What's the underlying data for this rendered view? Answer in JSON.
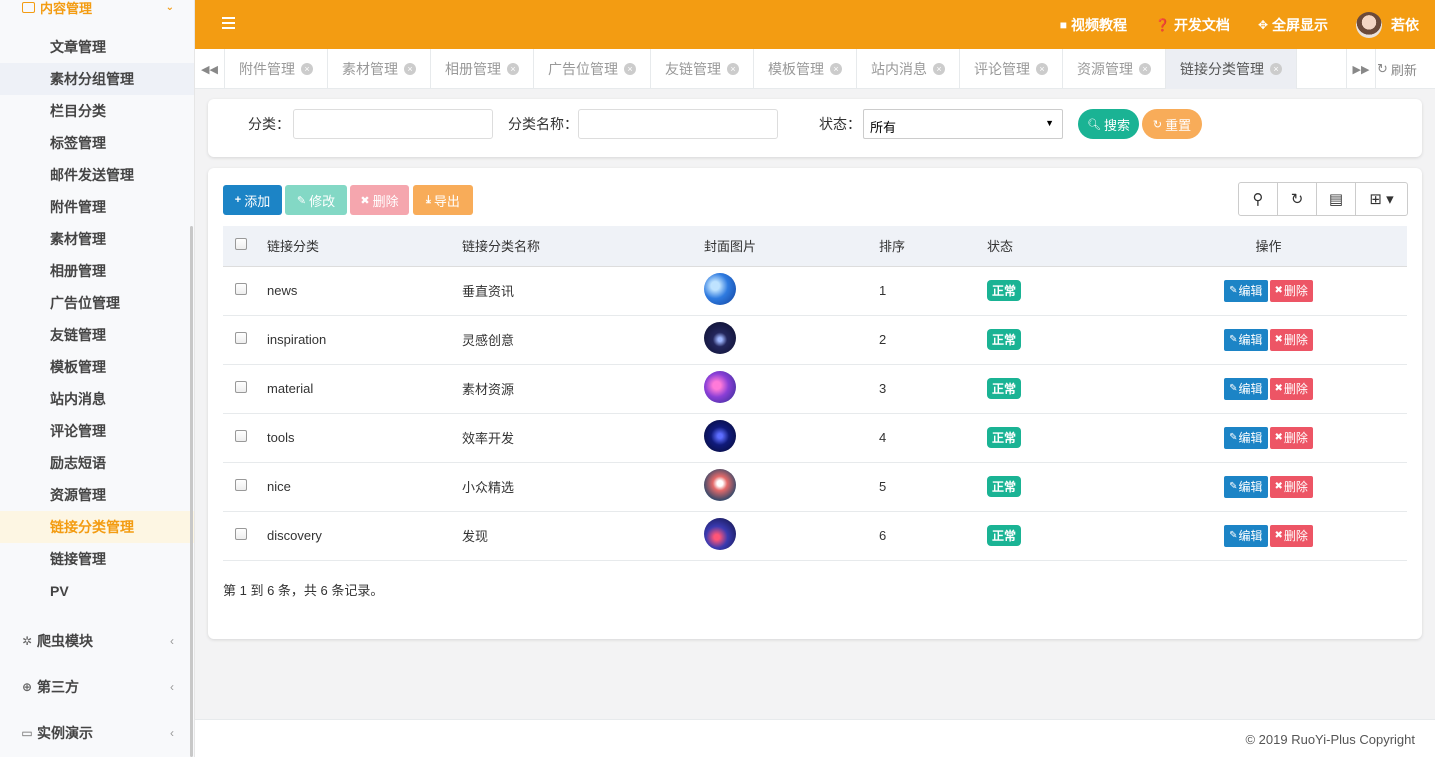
{
  "sidebar": {
    "group_title": "内容管理",
    "group_chevron": "⌄",
    "items": [
      {
        "label": "文章管理"
      },
      {
        "label": "素材分组管理"
      },
      {
        "label": "栏目分类"
      },
      {
        "label": "标签管理"
      },
      {
        "label": "邮件发送管理"
      },
      {
        "label": "附件管理"
      },
      {
        "label": "素材管理"
      },
      {
        "label": "相册管理"
      },
      {
        "label": "广告位管理"
      },
      {
        "label": "友链管理"
      },
      {
        "label": "模板管理"
      },
      {
        "label": "站内消息"
      },
      {
        "label": "评论管理"
      },
      {
        "label": "励志短语"
      },
      {
        "label": "资源管理"
      },
      {
        "label": "链接分类管理"
      },
      {
        "label": "链接管理"
      },
      {
        "label": "PV"
      }
    ],
    "modules": [
      {
        "label": "爬虫模块",
        "icon": "bug-icon"
      },
      {
        "label": "第三方",
        "icon": "lifebuoy-icon"
      },
      {
        "label": "实例演示",
        "icon": "desktop-icon"
      }
    ]
  },
  "header": {
    "nav": [
      {
        "label": "视频教程",
        "icon": "video-camera-icon"
      },
      {
        "label": "开发文档",
        "icon": "question-circle-icon"
      },
      {
        "label": "全屏显示",
        "icon": "arrows-alt-icon"
      }
    ],
    "user": "若依",
    "color": "#f39c12"
  },
  "tabs": {
    "items": [
      {
        "label": "附件管理"
      },
      {
        "label": "素材管理"
      },
      {
        "label": "相册管理"
      },
      {
        "label": "广告位管理"
      },
      {
        "label": "友链管理"
      },
      {
        "label": "模板管理"
      },
      {
        "label": "站内消息"
      },
      {
        "label": "评论管理"
      },
      {
        "label": "资源管理"
      },
      {
        "label": "链接分类管理"
      }
    ],
    "refresh_label": "刷新"
  },
  "search": {
    "category_label": "分类：",
    "category_value": "",
    "name_label": "分类名称：",
    "name_value": "",
    "status_label": "状态：",
    "status_value": "所有",
    "search_button": "搜索",
    "reset_button": "重置"
  },
  "toolbar": {
    "add": "添加",
    "edit": "修改",
    "delete": "删除",
    "export": "导出"
  },
  "table": {
    "headers": {
      "category": "链接分类",
      "name": "链接分类名称",
      "cover": "封面图片",
      "sort": "排序",
      "status": "状态",
      "ops": "操作"
    },
    "rows": [
      {
        "category": "news",
        "name": "垂直资讯",
        "sort": "1",
        "status": "正常",
        "edit": "编辑",
        "delete": "删除"
      },
      {
        "category": "inspiration",
        "name": "灵感创意",
        "sort": "2",
        "status": "正常",
        "edit": "编辑",
        "delete": "删除"
      },
      {
        "category": "material",
        "name": "素材资源",
        "sort": "3",
        "status": "正常",
        "edit": "编辑",
        "delete": "删除"
      },
      {
        "category": "tools",
        "name": "效率开发",
        "sort": "4",
        "status": "正常",
        "edit": "编辑",
        "delete": "删除"
      },
      {
        "category": "nice",
        "name": "小众精选",
        "sort": "5",
        "status": "正常",
        "edit": "编辑",
        "delete": "删除"
      },
      {
        "category": "discovery",
        "name": "发现",
        "sort": "6",
        "status": "正常",
        "edit": "编辑",
        "delete": "删除"
      }
    ],
    "pager_text": "第 1 到 6 条，共 6 条记录。"
  },
  "footer": {
    "copyright": "© 2019 RuoYi-Plus Copyright"
  },
  "colors": {
    "accent": "#f39c12",
    "success": "#1ab394",
    "primary": "#1c84c6",
    "danger": "#ed5565"
  }
}
